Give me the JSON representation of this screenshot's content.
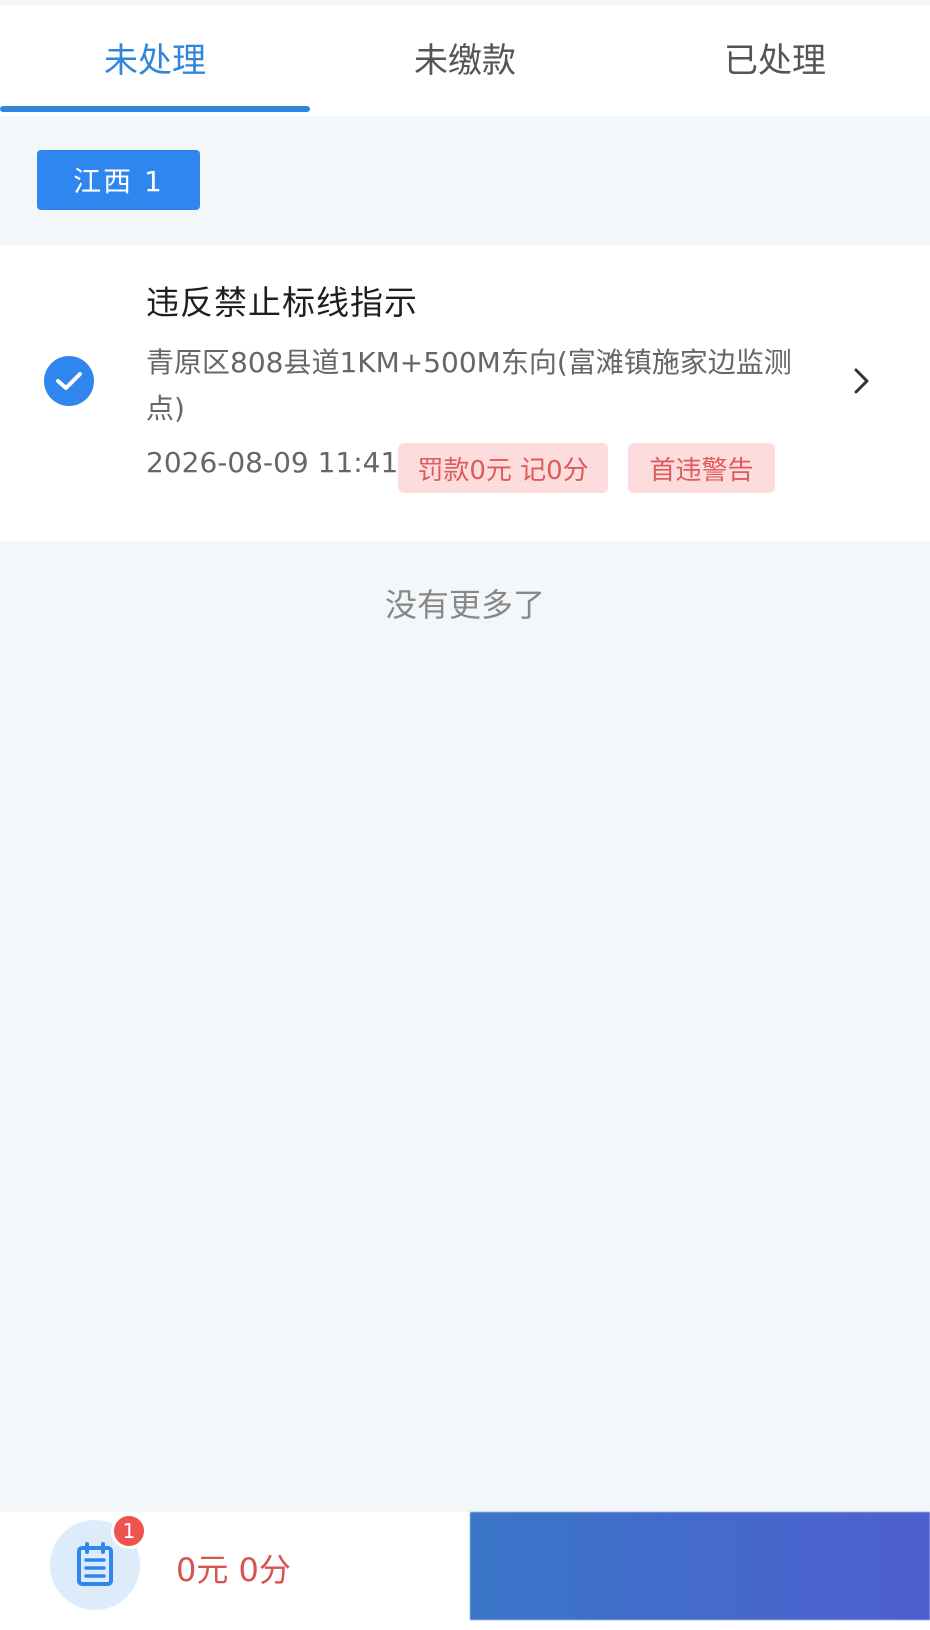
{
  "tabs": [
    {
      "label": "未处理",
      "active": true
    },
    {
      "label": "未缴款",
      "active": false
    },
    {
      "label": "已处理",
      "active": false
    }
  ],
  "plate": {
    "label": "江西 1"
  },
  "violation": {
    "title": "违反禁止标线指示",
    "address": "青原区808县道1KM+500M东向(富滩镇施家边监测点)",
    "time": "2026-08-09 11:41",
    "fine_tag": "罚款0元 记0分",
    "warn_tag": "首违警告",
    "selected": true
  },
  "list_end": "没有更多了",
  "bottom": {
    "badge": "1",
    "total": "0元 0分",
    "action_label": ""
  },
  "colors": {
    "accent": "#2f86dc",
    "tag_bg": "#fcdcdc",
    "tag_text": "#e05a5a",
    "total_text": "#d9534f"
  },
  "icons": {
    "check": "check-circle-icon",
    "chevron": "chevron-right-icon",
    "notebook": "notebook-icon"
  }
}
